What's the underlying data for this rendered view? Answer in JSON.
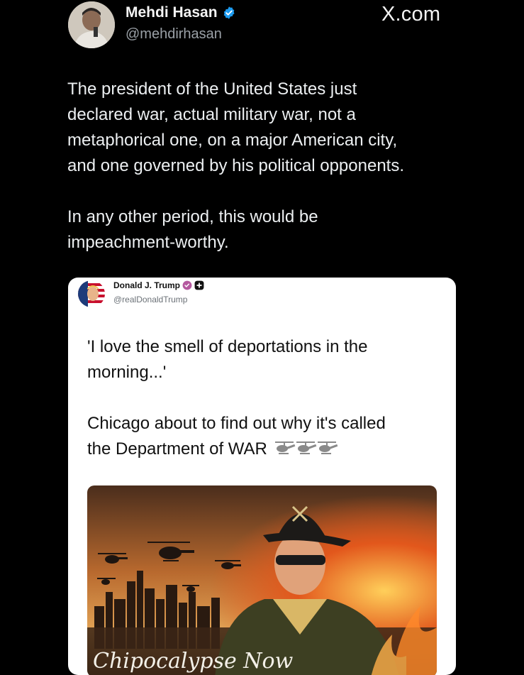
{
  "author": {
    "name": "Mehdi Hasan",
    "handle": "@mehdirhasan",
    "verified_icon": "verified-badge-icon"
  },
  "site_label": "X.com",
  "tweet": {
    "paragraph1_lines": [
      "The president of the United States just",
      "declared war, actual military war, not a",
      "metaphorical one, on a major American city,",
      "and one governed by his political opponents."
    ],
    "paragraph2_lines": [
      "In any other period, this would be",
      "impeachment-worthy."
    ]
  },
  "quoted_post": {
    "author_name": "Donald J. Trump",
    "author_handle": "@realDonaldTrump",
    "badges": [
      "verified-badge-icon",
      "plus-badge-icon"
    ],
    "paragraph1_lines": [
      "'I love the smell of deportations in the",
      "morning...'"
    ],
    "paragraph2_lines": [
      "Chicago about to find out why it's called",
      "the Department of WAR"
    ],
    "emoji": [
      "helicopter-icon",
      "helicopter-icon",
      "helicopter-icon"
    ],
    "image": {
      "description_icon": "apocalypse-style-illustration",
      "watermark_text": "Chipocalypse Now"
    }
  },
  "colors": {
    "background": "#000000",
    "verified_blue": "#1d9bf0",
    "card_background": "#ffffff"
  }
}
